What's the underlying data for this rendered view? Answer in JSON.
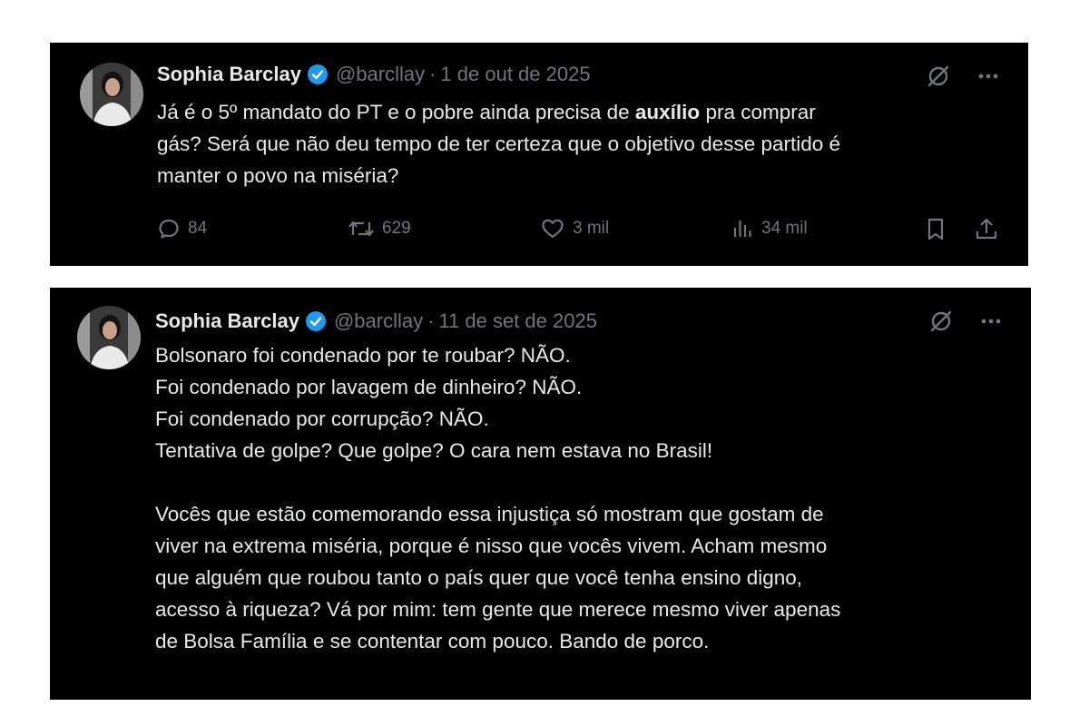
{
  "tweets": [
    {
      "author": {
        "name": "Sophia Barclay",
        "handle": "@barcllay"
      },
      "separator": "·",
      "date": "1 de out de 2025",
      "text": {
        "line1_before": "Já é o 5º mandato do PT e o pobre ainda precisa de ",
        "line1_bold": "auxílio",
        "line1_after": " pra comprar",
        "line2": "gás? Será que não deu tempo de ter certeza que o objetivo desse partido é",
        "line3": "manter o povo na miséria?"
      },
      "stats": {
        "replies": "84",
        "reposts": "629",
        "likes": "3 mil",
        "views": "34 mil"
      }
    },
    {
      "author": {
        "name": "Sophia Barclay",
        "handle": "@barcllay"
      },
      "separator": "·",
      "date": "11 de set de 2025",
      "lines": [
        "Bolsonaro foi condenado por te roubar? NÃO.",
        "Foi condenado por lavagem de dinheiro? NÃO.",
        "Foi condenado por corrupção? NÃO.",
        "Tentativa de golpe? Que golpe? O cara nem estava no Brasil!",
        "",
        "Vocês que estão comemorando essa injustiça só mostram que gostam de",
        "viver na extrema miséria, porque é nisso que vocês vivem. Acham mesmo",
        "que alguém que roubou tanto o país quer que você tenha ensino digno,",
        "acesso à riqueza? Vá por mim: tem gente que merece mesmo viver apenas",
        "de Bolsa Família e se contentar com pouco. Bando de porco."
      ]
    }
  ],
  "icons": {
    "verified": "verified-badge-icon",
    "grok": "grok-icon",
    "more": "more-icon",
    "reply": "reply-icon",
    "repost": "repost-icon",
    "like": "like-icon",
    "views": "views-icon",
    "bookmark": "bookmark-icon",
    "share": "share-icon"
  },
  "colors": {
    "background": "#000000",
    "text": "#e7e9ea",
    "muted": "#71767b",
    "verified": "#1d9bf0"
  }
}
